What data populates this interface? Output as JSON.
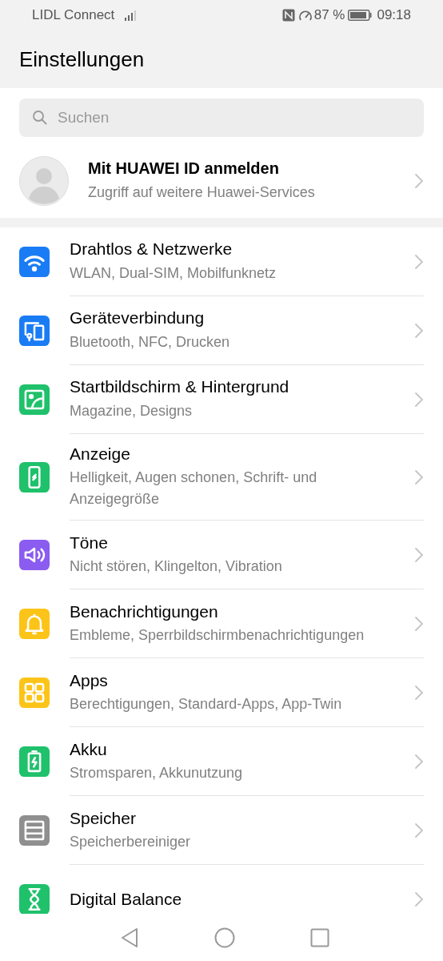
{
  "status_bar": {
    "carrier": "LIDL Connect",
    "battery": "87 %",
    "time": "09:18"
  },
  "header": {
    "title": "Einstellungen"
  },
  "search": {
    "placeholder": "Suchen"
  },
  "account": {
    "title": "Mit HUAWEI ID anmelden",
    "subtitle": "Zugriff auf weitere Huawei-Services"
  },
  "settings": [
    {
      "kind": "wifi",
      "color": "#1a7cf5",
      "title": "Drahtlos & Netzwerke",
      "subtitle": "WLAN, Dual-SIM, Mobilfunknetz"
    },
    {
      "kind": "devices",
      "color": "#1a7cf5",
      "title": "Geräteverbindung",
      "subtitle": "Bluetooth, NFC, Drucken"
    },
    {
      "kind": "wallpaper",
      "color": "#1fc16b",
      "title": "Startbildschirm & Hintergrund",
      "subtitle": "Magazine, Designs"
    },
    {
      "kind": "display",
      "color": "#1fc16b",
      "title": "Anzeige",
      "subtitle": "Helligkeit, Augen schonen, Schrift- und Anzeigegröße"
    },
    {
      "kind": "sound",
      "color": "#8a5cf0",
      "title": "Töne",
      "subtitle": "Nicht stören, Klingelton, Vibration"
    },
    {
      "kind": "bell",
      "color": "#fcc419",
      "title": "Benachrichtigungen",
      "subtitle": "Embleme, Sperrbildschirmbenachrichtigungen"
    },
    {
      "kind": "apps",
      "color": "#fcc419",
      "title": "Apps",
      "subtitle": "Berechtigungen, Standard-Apps, App-Twin"
    },
    {
      "kind": "battery",
      "color": "#1fc16b",
      "title": "Akku",
      "subtitle": "Stromsparen, Akkunutzung"
    },
    {
      "kind": "storage",
      "color": "#8f8f8f",
      "title": "Speicher",
      "subtitle": "Speicherbereiniger"
    },
    {
      "kind": "hourglass",
      "color": "#1fc16b",
      "title": "Digital Balance"
    }
  ]
}
